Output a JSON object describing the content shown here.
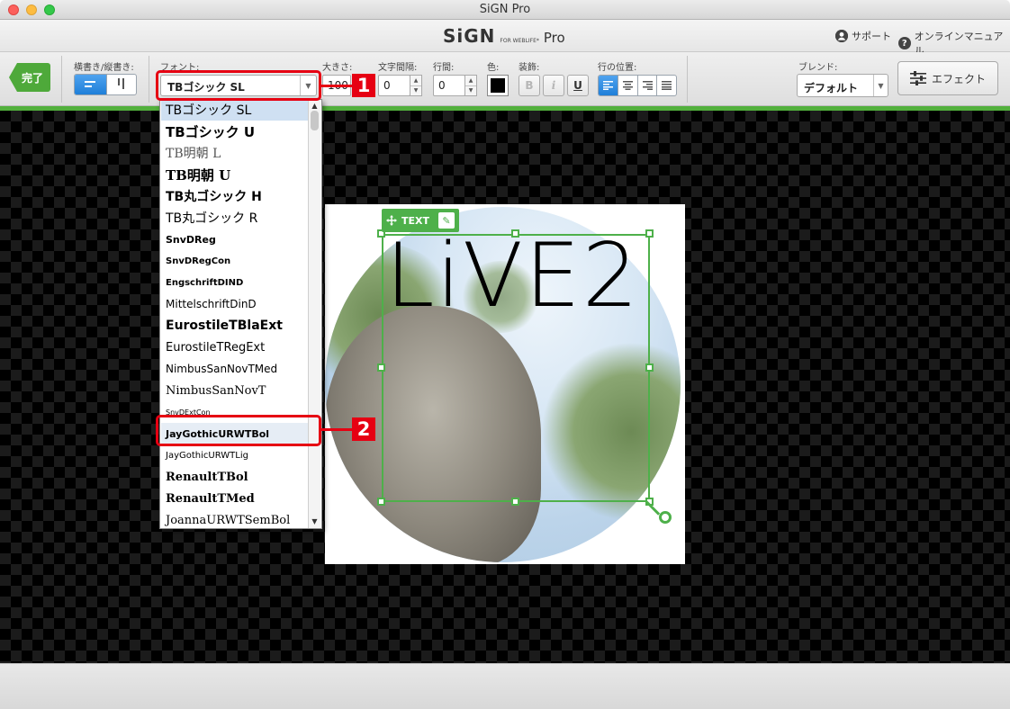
{
  "window": {
    "title": "SiGN Pro"
  },
  "header": {
    "logo_main": "SiGN",
    "logo_sub": "FOR WEBLIFE*",
    "logo_pro": "Pro",
    "support_label": "サポート",
    "manual_label": "オンラインマニュアル"
  },
  "toolbar": {
    "done_label": "完了",
    "orientation_label": "横書き/縦書き:",
    "font_label": "フォント:",
    "font_value": "TBゴシック SL",
    "size_label": "大きさ:",
    "size_value": "100",
    "char_spacing_label": "文字間隔:",
    "char_spacing_value": "0",
    "line_spacing_label": "行間:",
    "line_spacing_value": "0",
    "color_label": "色:",
    "decoration_label": "装飾:",
    "bold_label": "B",
    "italic_label": "i",
    "underline_label": "U",
    "align_label": "行の位置:",
    "blend_label": "ブレンド:",
    "blend_value": "デフォルト",
    "effect_label": "エフェクト",
    "text_color": "#000000",
    "accent_color": "#4eb04a"
  },
  "font_list": [
    {
      "label": "TBゴシック SL",
      "weight": "normal",
      "size": 14,
      "family": "sans",
      "state": "current"
    },
    {
      "label": "TBゴシック U",
      "weight": "bold",
      "size": 15,
      "family": "sans"
    },
    {
      "label": "TB明朝 L",
      "weight": "normal",
      "size": 14,
      "family": "serif",
      "color": "#555"
    },
    {
      "label": "TB明朝 U",
      "weight": "bold",
      "size": 15,
      "family": "serif"
    },
    {
      "label": "TB丸ゴシック H",
      "weight": "bold",
      "size": 14,
      "family": "sans"
    },
    {
      "label": "TB丸ゴシック R",
      "weight": "normal",
      "size": 14,
      "family": "sans"
    },
    {
      "label": "SnvDReg",
      "weight": "bold",
      "size": 11,
      "family": "sans"
    },
    {
      "label": "SnvDRegCon",
      "weight": "bold",
      "size": 10,
      "family": "sans"
    },
    {
      "label": "EngschriftDIND",
      "weight": "bold",
      "size": 10,
      "family": "sans"
    },
    {
      "label": "MittelschriftDinD",
      "weight": "normal",
      "size": 12,
      "family": "sans"
    },
    {
      "label": "EurostileTBlaExt",
      "weight": "bold",
      "size": 14,
      "family": "sans"
    },
    {
      "label": "EurostileTRegExt",
      "weight": "normal",
      "size": 13,
      "family": "sans"
    },
    {
      "label": "NimbusSanNovTMed",
      "weight": "normal",
      "size": 12,
      "family": "sans"
    },
    {
      "label": "NimbusSanNovT",
      "weight": "normal",
      "size": 13,
      "family": "serif"
    },
    {
      "label": "SnvDExtCon",
      "weight": "normal",
      "size": 8,
      "family": "sans"
    },
    {
      "label": "JayGothicURWTBol",
      "weight": "bold",
      "size": 11,
      "family": "sans",
      "state": "selected"
    },
    {
      "label": "JayGothicURWTLig",
      "weight": "normal",
      "size": 10,
      "family": "sans"
    },
    {
      "label": "RenaultTBol",
      "weight": "bold",
      "size": 13,
      "family": "serif"
    },
    {
      "label": "RenaultTMed",
      "weight": "bold",
      "size": 13,
      "family": "serif"
    },
    {
      "label": "JoannaURWTSemBol",
      "weight": "normal",
      "size": 13,
      "family": "serif"
    }
  ],
  "canvas": {
    "text_tag_label": "TEXT",
    "text_content": "LiVE2"
  },
  "callouts": [
    {
      "number": "1"
    },
    {
      "number": "2"
    }
  ],
  "icons": {
    "done": "arrow-left-shape",
    "horizontal": "horizontal-text-icon",
    "vertical": "vertical-text-icon",
    "support": "user-icon",
    "manual": "help-icon",
    "effect": "sliders-icon",
    "move": "move-icon",
    "edit": "pencil-icon"
  }
}
